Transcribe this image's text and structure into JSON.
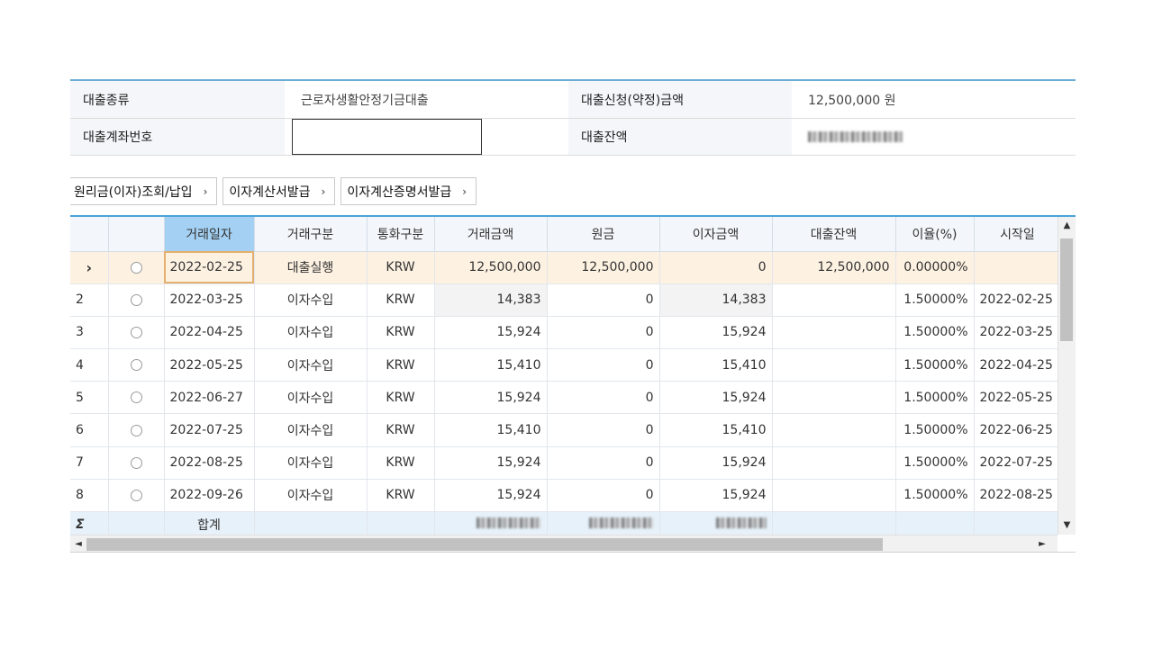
{
  "info": {
    "loan_type_label": "대출종류",
    "loan_type_value": "근로자생활안정기금대출",
    "loan_amount_label": "대출신청(약정)금액",
    "loan_amount_value": "12,500,000 원",
    "account_label": "대출계좌번호",
    "balance_label": "대출잔액"
  },
  "buttons": {
    "principal": "원리금(이자)조회/납입",
    "calc_statement": "이자계산서발급",
    "calc_certificate": "이자계산증명서발급",
    "chevron": "›"
  },
  "grid": {
    "headers": [
      "거래일자",
      "거래구분",
      "통화구분",
      "거래금액",
      "원금",
      "이자금액",
      "대출잔액",
      "이율(%)",
      "시작일"
    ],
    "current_marker": "›",
    "rows": [
      {
        "no": "",
        "date": "2022-02-25",
        "type": "대출실행",
        "currency": "KRW",
        "amount": "12,500,000",
        "principal": "12,500,000",
        "interest": "0",
        "balance": "12,500,000",
        "rate": "0.00000%",
        "start": ""
      },
      {
        "no": "2",
        "date": "2022-03-25",
        "type": "이자수입",
        "currency": "KRW",
        "amount": "14,383",
        "principal": "0",
        "interest": "14,383",
        "balance": "",
        "rate": "1.50000%",
        "start": "2022-02-25"
      },
      {
        "no": "3",
        "date": "2022-04-25",
        "type": "이자수입",
        "currency": "KRW",
        "amount": "15,924",
        "principal": "0",
        "interest": "15,924",
        "balance": "",
        "rate": "1.50000%",
        "start": "2022-03-25"
      },
      {
        "no": "4",
        "date": "2022-05-25",
        "type": "이자수입",
        "currency": "KRW",
        "amount": "15,410",
        "principal": "0",
        "interest": "15,410",
        "balance": "",
        "rate": "1.50000%",
        "start": "2022-04-25"
      },
      {
        "no": "5",
        "date": "2022-06-27",
        "type": "이자수입",
        "currency": "KRW",
        "amount": "15,924",
        "principal": "0",
        "interest": "15,924",
        "balance": "",
        "rate": "1.50000%",
        "start": "2022-05-25"
      },
      {
        "no": "6",
        "date": "2022-07-25",
        "type": "이자수입",
        "currency": "KRW",
        "amount": "15,410",
        "principal": "0",
        "interest": "15,410",
        "balance": "",
        "rate": "1.50000%",
        "start": "2022-06-25"
      },
      {
        "no": "7",
        "date": "2022-08-25",
        "type": "이자수입",
        "currency": "KRW",
        "amount": "15,924",
        "principal": "0",
        "interest": "15,924",
        "balance": "",
        "rate": "1.50000%",
        "start": "2022-07-25"
      },
      {
        "no": "8",
        "date": "2022-09-26",
        "type": "이자수입",
        "currency": "KRW",
        "amount": "15,924",
        "principal": "0",
        "interest": "15,924",
        "balance": "",
        "rate": "1.50000%",
        "start": "2022-08-25"
      }
    ],
    "sum_symbol": "Σ",
    "sum_label": "합계"
  },
  "scroll": {
    "up": "▲",
    "down": "▼",
    "left": "◄",
    "right": "►"
  },
  "colors": {
    "accent": "#4aa3d8",
    "selected_header": "#a4d1f3",
    "current_row": "#fdf1e1",
    "sum_row": "#e6f1fa"
  }
}
